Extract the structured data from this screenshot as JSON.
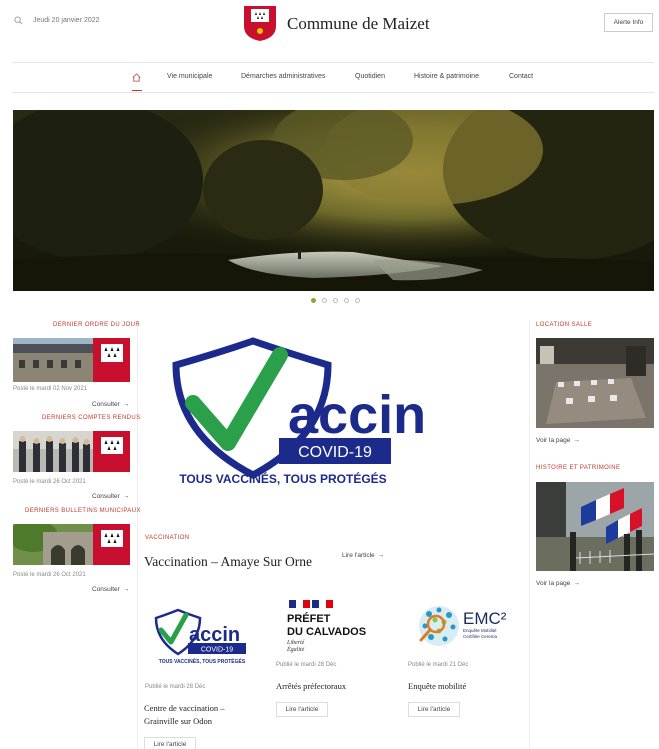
{
  "header": {
    "date": "Jeudi 20 janvier 2022",
    "title": "Commune de Maizet",
    "alert_label": "Alerte Info"
  },
  "nav": {
    "items": [
      "Vie municipale",
      "Démarches administratives",
      "Quotidien",
      "Histoire & patrimoine",
      "Contact"
    ]
  },
  "left": {
    "sections": [
      {
        "heading": "Dernier ordre du jour",
        "posted": "Posté le mardi 02 Nov 2021",
        "link": "Consulter"
      },
      {
        "heading": "Derniers comptes rendus",
        "posted": "Posté le mardi 26 Oct 2021",
        "link": "Consulter"
      },
      {
        "heading": "Derniers bulletins municipaux",
        "posted": "Posté le mardi 26 Oct 2021",
        "link": "Consulter"
      }
    ]
  },
  "featured": {
    "logo_word": "accin",
    "logo_badge": "COVID-19",
    "logo_tagline": "TOUS VACCINÉS, TOUS PROTÉGÉS",
    "category": "Vaccination",
    "title": "Vaccination – Amaye Sur Orne",
    "link": "Lire l'article"
  },
  "cards": [
    {
      "posted": "Publié le mardi 28 Déc",
      "title": "Centre de vaccination – Grainville sur Odon",
      "link": "Lire l'article",
      "logo_word": "accin",
      "logo_badge": "COVID-19",
      "logo_tagline": "TOUS VACCINÉS, TOUS PROTÉGÉS"
    },
    {
      "posted": "Publié le mardi 28 Déc",
      "title": "Arrêtés préfectoraux",
      "link": "Lire l'article",
      "logo_line1": "PRÉFET",
      "logo_line2": "DU CALVADOS",
      "logo_motto1": "Liberté",
      "logo_motto2": "Égalité"
    },
    {
      "posted": "Publié le mardi 21 Déc",
      "title": "Enquête mobilité",
      "link": "Lire l'article",
      "logo_word": "EMC²",
      "logo_sub1": "Enquête Mobilité",
      "logo_sub2": "Certifiée Cerema"
    }
  ],
  "right": {
    "sections": [
      {
        "heading": "Location salle",
        "link": "Voir la page"
      },
      {
        "heading": "Histoire et patrimoine",
        "link": "Voir la page"
      }
    ]
  },
  "colors": {
    "accent": "#c0392b",
    "vaccin_blue": "#1c2a8c",
    "vaccin_green": "#2aa04a",
    "slider_active": "#8aa53b"
  }
}
